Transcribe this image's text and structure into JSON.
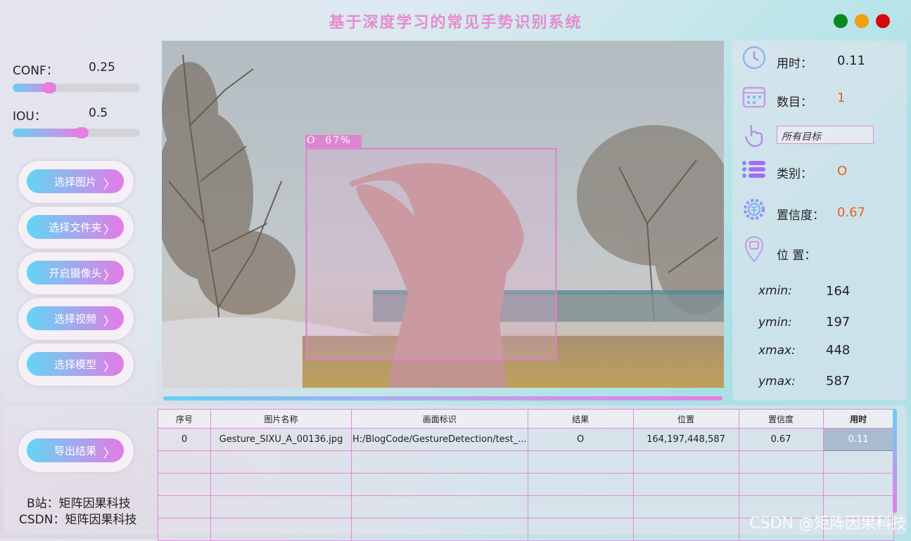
{
  "window": {
    "title": "基于深度学习的常见手势识别系统",
    "controls": [
      {
        "name": "minimize",
        "color": "#0a8a1e"
      },
      {
        "name": "maximize",
        "color": "#f0a012"
      },
      {
        "name": "close",
        "color": "#d40a0a"
      }
    ]
  },
  "params": {
    "conf_label": "CONF：",
    "conf_value": "0.25",
    "conf_fraction": 0.25,
    "iou_label": "IOU：",
    "iou_value": "0.5",
    "iou_fraction": 0.5
  },
  "buttons": {
    "select_image": "选择图片",
    "select_folder": "选择文件夹",
    "open_camera": "开启摄像头",
    "select_video": "选择视频",
    "select_model": "选择模型",
    "export": "导出结果"
  },
  "detection": {
    "box_label": "O  67%"
  },
  "info": {
    "time_label": "用时：",
    "time_value": "0.11",
    "count_label": "数目：",
    "count_value": "1",
    "target_select": "所有目标",
    "class_label": "类别：",
    "class_value": "O",
    "conf_label": "置信度：",
    "conf_value": "0.67",
    "position_label": "位 置：",
    "xmin_label": "xmin:",
    "xmin_value": "164",
    "ymin_label": "ymin:",
    "ymin_value": "197",
    "xmax_label": "xmax:",
    "xmax_value": "448",
    "ymax_label": "ymax:",
    "ymax_value": "587",
    "accent": "#e8611f"
  },
  "table": {
    "headers": [
      "序号",
      "图片名称",
      "画面标识",
      "结果",
      "位置",
      "置信度",
      "用时"
    ],
    "rows": [
      [
        "0",
        "Gesture_SIXU_A_00136.jpg",
        "H:/BlogCode/GestureDetection/test_...",
        "O",
        "164,197,448,587",
        "0.67",
        "0.11"
      ]
    ]
  },
  "credits": {
    "bilibili": "B站：矩阵因果科技",
    "csdn": "CSDN：矩阵因果科技"
  },
  "watermark": "CSDN @矩阵因果科技"
}
